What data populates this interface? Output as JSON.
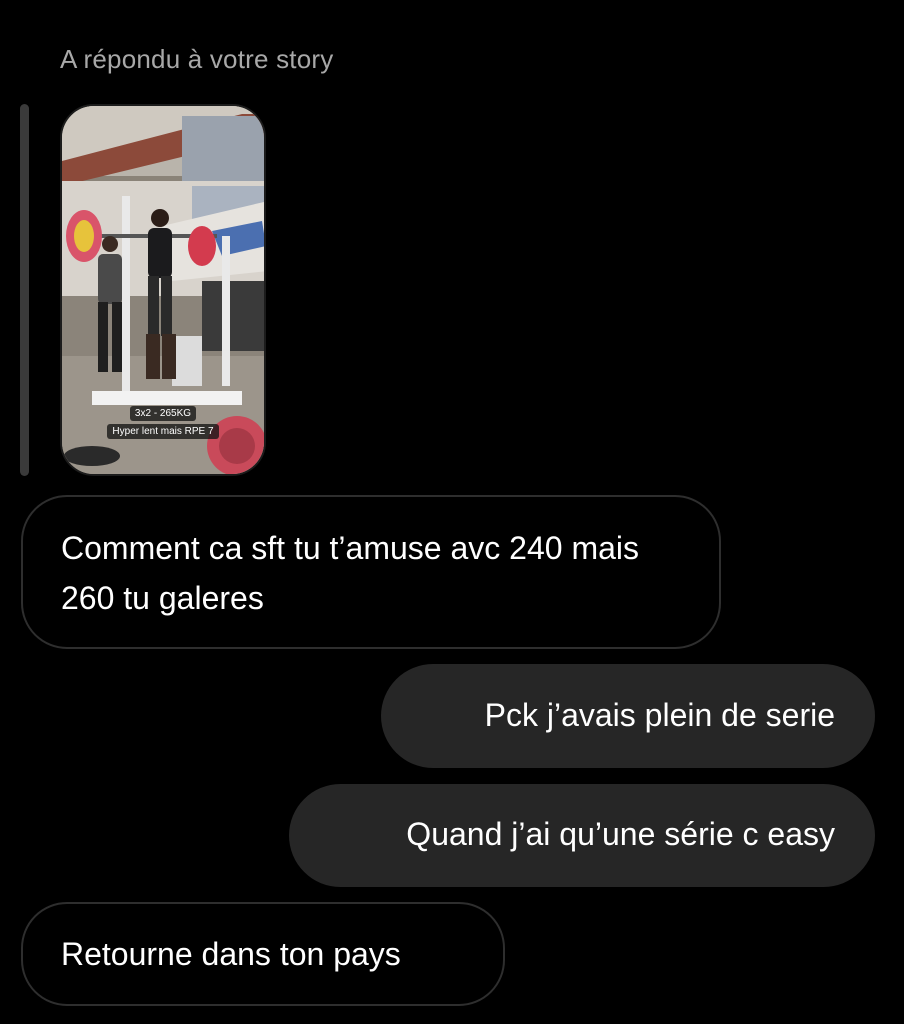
{
  "story_reply": {
    "label": "A répondu à votre story",
    "thumbnail": {
      "caption_line1": "3x2 - 265KG",
      "caption_line2": "Hyper lent mais RPE 7"
    }
  },
  "messages": [
    {
      "direction": "incoming",
      "text": "Comment ca sft tu t’amuse avc 240 mais 260 tu galeres"
    },
    {
      "direction": "outgoing",
      "text": "Pck j’avais plein de serie"
    },
    {
      "direction": "outgoing",
      "text": "Quand j’ai qu’une série c easy"
    },
    {
      "direction": "incoming",
      "text": "Retourne dans ton pays"
    }
  ],
  "colors": {
    "background": "#000000",
    "incoming_border": "#2e2e2e",
    "outgoing_bubble": "#262626",
    "label_text": "#a8a8a8",
    "message_text": "#ffffff"
  }
}
